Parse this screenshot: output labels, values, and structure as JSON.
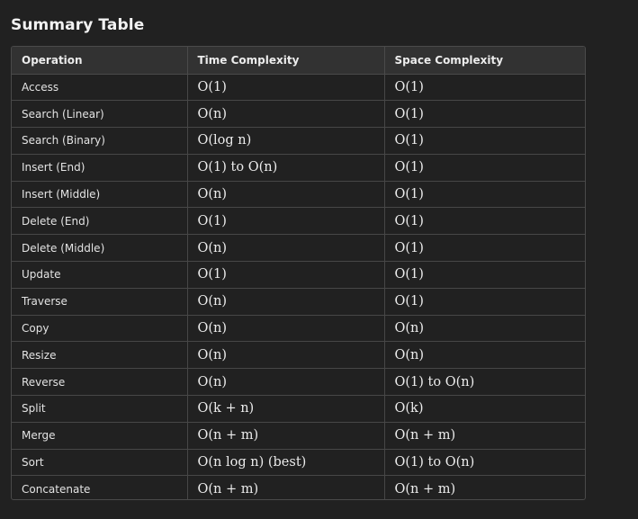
{
  "heading": "Summary Table",
  "table": {
    "headers": [
      "Operation",
      "Time Complexity",
      "Space Complexity"
    ],
    "rows": [
      [
        "Access",
        "O(1)",
        "O(1)"
      ],
      [
        "Search (Linear)",
        "O(n)",
        "O(1)"
      ],
      [
        "Search (Binary)",
        "O(log n)",
        "O(1)"
      ],
      [
        "Insert (End)",
        "O(1) to O(n)",
        "O(1)"
      ],
      [
        "Insert (Middle)",
        "O(n)",
        "O(1)"
      ],
      [
        "Delete (End)",
        "O(1)",
        "O(1)"
      ],
      [
        "Delete (Middle)",
        "O(n)",
        "O(1)"
      ],
      [
        "Update",
        "O(1)",
        "O(1)"
      ],
      [
        "Traverse",
        "O(n)",
        "O(1)"
      ],
      [
        "Copy",
        "O(n)",
        "O(n)"
      ],
      [
        "Resize",
        "O(n)",
        "O(n)"
      ],
      [
        "Reverse",
        "O(n)",
        "O(1) to O(n)"
      ],
      [
        "Split",
        "O(k + n)",
        "O(k)"
      ],
      [
        "Merge",
        "O(n + m)",
        "O(n + m)"
      ],
      [
        "Sort",
        "O(n log n) (best)",
        "O(1) to O(n)"
      ],
      [
        "Concatenate",
        "O(n + m)",
        "O(n + m)"
      ]
    ]
  },
  "colors": {
    "background": "#212121",
    "header_background": "#323232",
    "border": "#4a4a4a",
    "text": "#ececec"
  }
}
